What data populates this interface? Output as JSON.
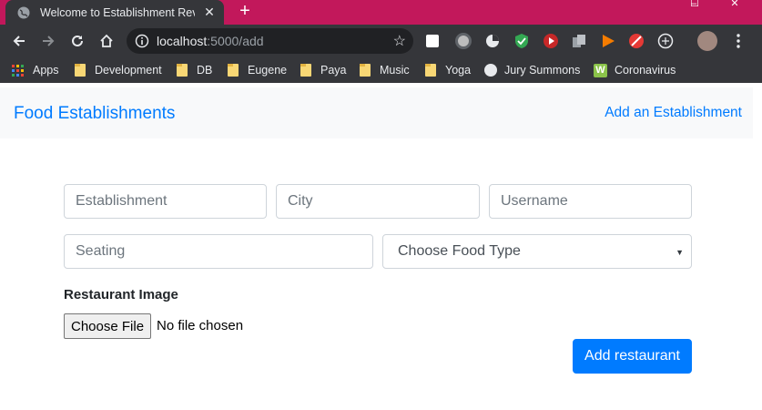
{
  "browser": {
    "tab": {
      "title": "Welcome to Establishment Review",
      "favicon": "globe-icon"
    },
    "new_tab_symbol": "+",
    "window_controls": {
      "minimize": "–",
      "maximize": "☐",
      "close": "✕"
    },
    "omnibox": {
      "host": "localhost",
      "path": ":5000/add"
    },
    "bookmarks": [
      {
        "label": "Apps",
        "icon": "apps-grid-icon"
      },
      {
        "label": "Development",
        "icon": "folder-icon"
      },
      {
        "label": "DB",
        "icon": "folder-icon"
      },
      {
        "label": "Eugene",
        "icon": "folder-icon"
      },
      {
        "label": "Paya",
        "icon": "folder-icon"
      },
      {
        "label": "Music",
        "icon": "folder-icon"
      },
      {
        "label": "Yoga",
        "icon": "folder-icon"
      },
      {
        "label": "Jury Summons",
        "icon": "globe-icon"
      },
      {
        "label": "Coronavirus",
        "icon": "w-icon"
      }
    ],
    "w_icon_glyph": "W",
    "colors": {
      "tabstrip": "#c2185b",
      "toolbar": "#35363a",
      "omnibox": "#202124"
    }
  },
  "navbar": {
    "brand": "Food Establishments",
    "link": "Add an Establishment"
  },
  "form": {
    "establishment_placeholder": "Establishment",
    "city_placeholder": "City",
    "username_placeholder": "Username",
    "seating_placeholder": "Seating",
    "food_type_selected": "Choose Food Type",
    "image_label": "Restaurant Image",
    "file_button": "Choose File",
    "file_status": "No file chosen",
    "submit_label": "Add restaurant"
  },
  "colors": {
    "accent": "#007bff",
    "navbar_bg": "#f8f9fa",
    "border": "#ced4da"
  }
}
